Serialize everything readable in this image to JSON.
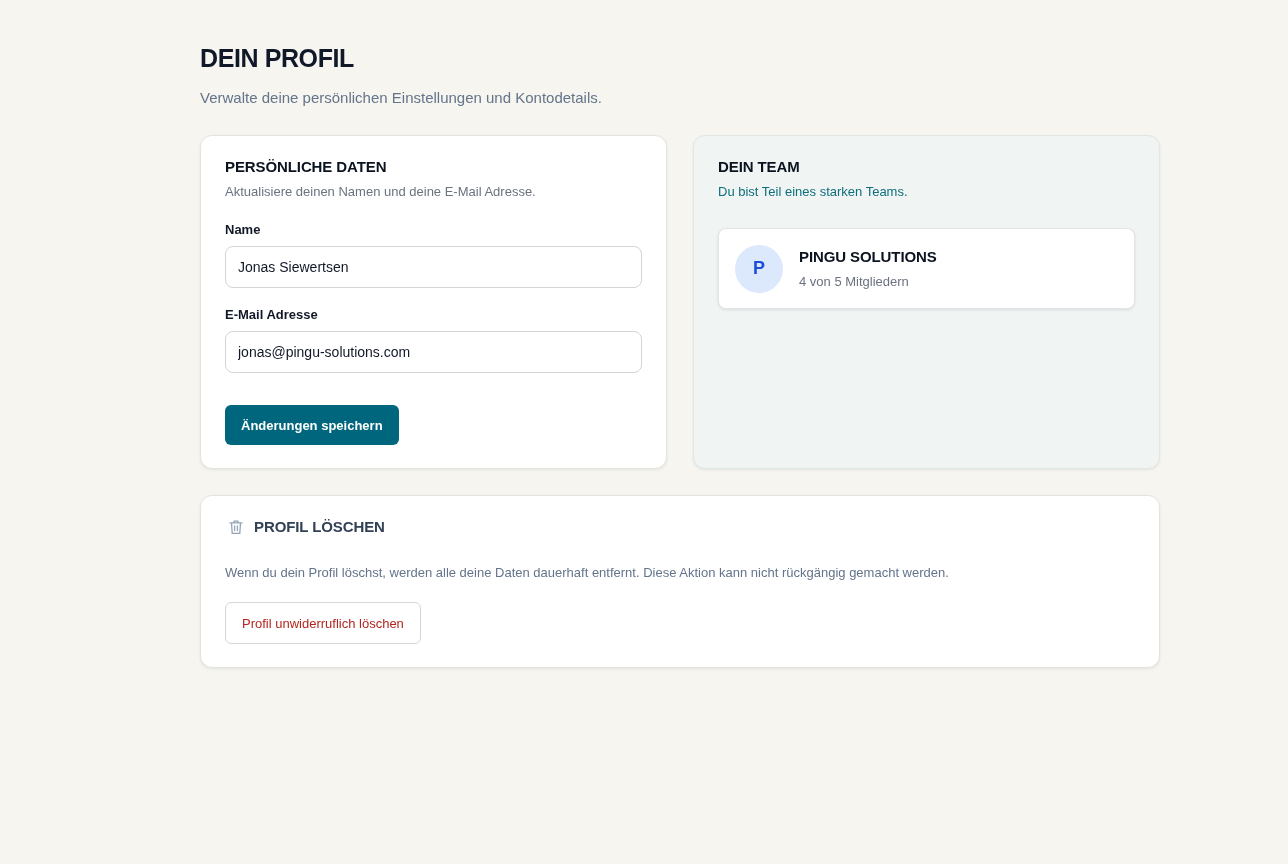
{
  "header": {
    "title": "DEIN PROFIL",
    "subtitle": "Verwalte deine persönlichen Einstellungen und Kontodetails."
  },
  "personal_data": {
    "title": "PERSÖNLICHE DATEN",
    "subtitle": "Aktualisiere deinen Namen und deine E-Mail Adresse.",
    "fields": [
      {
        "label": "Name",
        "value": "Jonas Siewertsen"
      },
      {
        "label": "E-Mail Adresse",
        "value": "jonas@pingu-solutions.com"
      }
    ],
    "save_button": "Änderungen speichern"
  },
  "team": {
    "title": "DEIN TEAM",
    "subtitle": "Du bist Teil eines starken Teams.",
    "teams": [
      {
        "initial": "P",
        "name": "PINGU SOLUTIONS",
        "members": "4 von 5 Mitgliedern"
      }
    ]
  },
  "delete_profile": {
    "title": "PROFIL LÖSCHEN",
    "description": "Wenn du dein Profil löschst, werden alle deine Daten dauerhaft entfernt. Diese Aktion kann nicht rückgängig gemacht werden.",
    "delete_button": "Profil unwiderruflich löschen"
  }
}
